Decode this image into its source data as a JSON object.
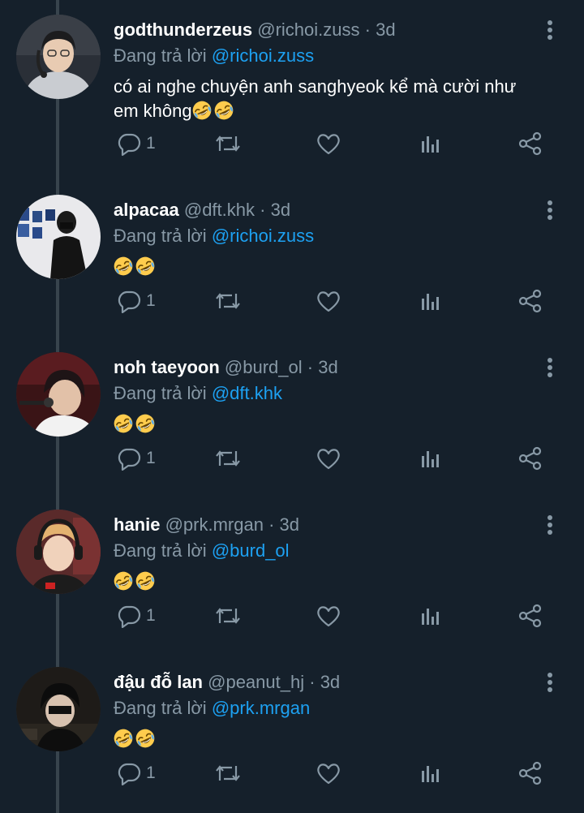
{
  "colors": {
    "background": "#15202b",
    "name": "#ffffff",
    "secondary_text": "#8899a6",
    "mention": "#1da1f2",
    "icon": "#8899a6",
    "thread_line": "#38444d"
  },
  "replying_prefix": "Đang trả lời",
  "dot": "·",
  "tweets": [
    {
      "name": "godthunderzeus",
      "handle": "@richoi.zuss",
      "time": "3d",
      "replying_to": "@richoi.zuss",
      "text_line1": "có ai nghe chuyện anh sanghyeok kể mà cười như",
      "text_line2": "em không",
      "emoji_count": 2,
      "reply_count": "1",
      "avatar_icon": "person-headset-avatar"
    },
    {
      "name": "alpacaa",
      "handle": "@dft.khk",
      "time": "3d",
      "replying_to": "@richoi.zuss",
      "text_line1": "",
      "text_line2": "",
      "emoji_count": 2,
      "reply_count": "1",
      "avatar_icon": "person-mask-avatar"
    },
    {
      "name": "noh taeyoon",
      "handle": "@burd_ol",
      "time": "3d",
      "replying_to": "@dft.khk",
      "text_line1": "",
      "text_line2": "",
      "emoji_count": 2,
      "reply_count": "1",
      "avatar_icon": "person-microphone-avatar"
    },
    {
      "name": "hanie",
      "handle": "@prk.mrgan",
      "time": "3d",
      "replying_to": "@burd_ol",
      "text_line1": "",
      "text_line2": "",
      "emoji_count": 2,
      "reply_count": "1",
      "avatar_icon": "person-gaming-headset-avatar"
    },
    {
      "name": "đậu đỗ lan",
      "handle": "@peanut_hj",
      "time": "3d",
      "replying_to": "@prk.mrgan",
      "text_line1": "",
      "text_line2": "",
      "emoji_count": 2,
      "reply_count": "1",
      "avatar_icon": "person-dark-avatar"
    }
  ],
  "icons": {
    "reply": "reply-icon",
    "retweet": "retweet-icon",
    "like": "heart-icon",
    "analytics": "analytics-icon",
    "share": "share-icon",
    "more": "more-vertical-icon",
    "emoji": "rolling-on-floor-laughing-emoji"
  }
}
